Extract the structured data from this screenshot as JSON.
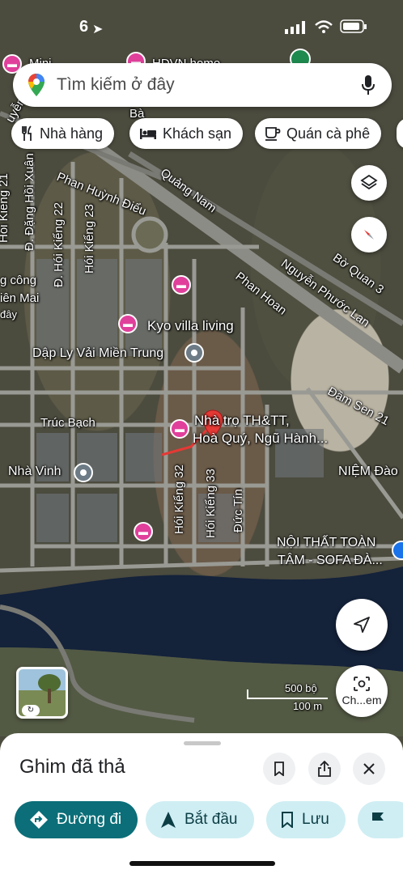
{
  "status_bar": {
    "time": "6"
  },
  "search": {
    "placeholder": "Tìm kiếm ở đây"
  },
  "chips": [
    {
      "label": "Nhà hàng",
      "icon": "restaurant-icon"
    },
    {
      "label": "Khách sạn",
      "icon": "hotel-icon"
    },
    {
      "label": "Quán cà phê",
      "icon": "coffee-icon"
    }
  ],
  "map": {
    "streets": {
      "phan_huynh_dieu": "Phan Huỳnh Điểu",
      "quang_nam": "Quảng Nam",
      "nguyen_phuoc_lan": "Nguyễn Phước Lan",
      "phan_hoan": "Phan Hoan",
      "bo_quan_3": "Bờ Quan 3",
      "dam_sen_21": "Đầm Sen 21",
      "truc_bach": "Trúc Bạch",
      "hoi_kieng_21": "Hói Kiểng 21",
      "dang_hoi_xuan": "Đ. Đặng Hồi Xuân",
      "hoi_kieng_22": "Đ. Hói Kiểng 22",
      "hoi_kieng_23": "Hói Kiểng 23",
      "hoi_kieng_32": "Hói Kiểng 32",
      "hoi_kieng_33": "Hói Kiểng 33",
      "duc_tin": "Đức Tín"
    },
    "places": {
      "kyo_villa": "Kyo villa living",
      "dap_ly": "Dập Ly Vải Miền Trung",
      "nha_vinh": "Nhà Vinh",
      "pin_line1": "Nhà trọ TH&TT,",
      "pin_line2": "Hoà Quý, Ngũ Hành...",
      "niem_dao": "NIỆM Đào",
      "noi_that_1": "NỘI THẤT TOÀN",
      "noi_that_2": "TÂM - SOFA ĐÀ...",
      "left_1": "g công",
      "left_2": "iên Mai",
      "left_3": "đây",
      "top_1": "Mini",
      "top_2": "HDVN home",
      "top_3": "uyễn",
      "top_4": "Bà"
    },
    "scale": {
      "label_1": "500 bộ",
      "label_2": "100 m"
    },
    "camera_label": "Ch...em",
    "accent_color": "#e53935",
    "poi_color": "#e0409b"
  },
  "sheet": {
    "title": "Ghim đã thả",
    "actions": [
      {
        "label": "Đường đi",
        "icon": "directions-icon"
      },
      {
        "label": "Bắt đầu",
        "icon": "navigation-arrow-icon"
      },
      {
        "label": "Lưu",
        "icon": "bookmark-icon"
      }
    ]
  }
}
